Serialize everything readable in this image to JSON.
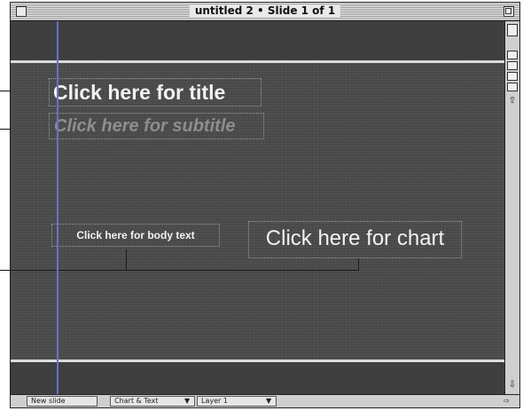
{
  "window": {
    "title": "untitled 2 • Slide 1 of 1"
  },
  "slide": {
    "title_placeholder": "Click here for title",
    "subtitle_placeholder": "Click here for subtitle",
    "body_placeholder": "Click here for body text",
    "chart_placeholder": "Click here for chart"
  },
  "status_bar": {
    "new_slide_label": "New slide",
    "layout_label": "Chart & Text",
    "layer_label": "Layer 1"
  },
  "icons": {
    "close": "close-box-icon",
    "zoom": "zoom-box-icon",
    "scroll_up": "scroll-up-arrow-icon",
    "scroll_down": "scroll-down-arrow-icon"
  },
  "colors": {
    "slide_background": "#4b4b4b",
    "band": "#3f3f3f",
    "guide": "#6a70c8"
  }
}
